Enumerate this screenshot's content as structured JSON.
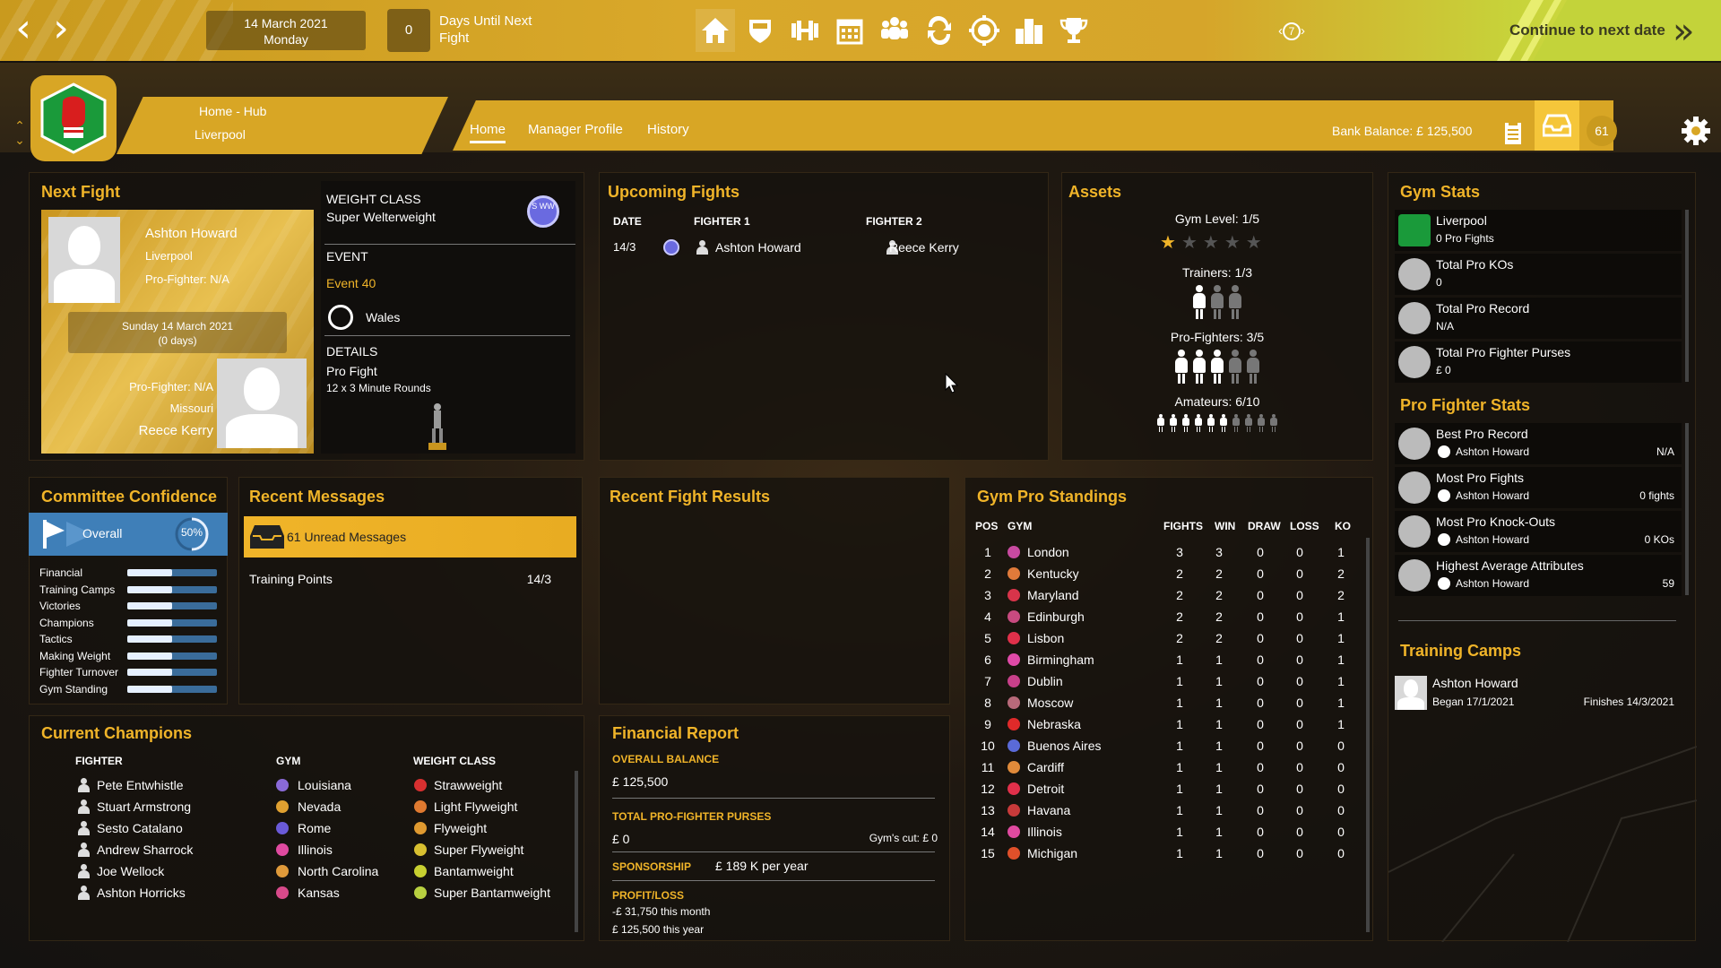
{
  "topbar": {
    "date_line1": "14 March 2021",
    "date_line2": "Monday",
    "days_until": "0",
    "days_label": "Days Until Next Fight",
    "icons": [
      "home-icon",
      "shield-icon",
      "dumbbell-icon",
      "calendar-icon",
      "fighters-icon",
      "transfer-icon",
      "target-icon",
      "rankings-icon",
      "trophy-icon"
    ],
    "round_badge": "7",
    "continue_label": "Continue to next date"
  },
  "header": {
    "crumb_title": "Home - Hub",
    "crumb_sub": "Liverpool",
    "tabs": [
      "Home",
      "Manager Profile",
      "History"
    ],
    "bank_balance": "Bank Balance: £ 125,500",
    "inbox_count": "61"
  },
  "next_fight": {
    "title": "Next Fight",
    "fighter1_name": "Ashton Howard",
    "fighter1_gym": "Liverpool",
    "fighter1_status": "Pro-Fighter: N/A",
    "date_line1": "Sunday 14 March 2021",
    "date_line2": "(0 days)",
    "fighter2_status": "Pro-Fighter: N/A",
    "fighter2_gym": "Missouri",
    "fighter2_name": "Reece Kerry",
    "weight_class_label": "WEIGHT CLASS",
    "weight_class": "Super Welterweight",
    "weight_badge": "S WW",
    "event_label": "EVENT",
    "event": "Event 40",
    "location": "Wales",
    "details_label": "DETAILS",
    "details_type": "Pro Fight",
    "details_rounds": "12 x 3 Minute Rounds"
  },
  "upcoming": {
    "title": "Upcoming Fights",
    "headers": [
      "DATE",
      "FIGHTER 1",
      "FIGHTER 2"
    ],
    "rows": [
      {
        "date": "14/3",
        "fighter1": "Ashton Howard",
        "fighter2": "Reece Kerry"
      }
    ]
  },
  "assets": {
    "title": "Assets",
    "gym_level": "Gym Level: 1/5",
    "gym_level_value": 1,
    "trainers": "Trainers: 1/3",
    "trainers_value": 1,
    "trainers_max": 3,
    "pro_fighters": "Pro-Fighters: 3/5",
    "pro_value": 3,
    "pro_max": 5,
    "amateurs": "Amateurs: 6/10",
    "amateur_value": 6,
    "amateur_max": 10
  },
  "gym_stats": {
    "title": "Gym Stats",
    "items": [
      {
        "label": "Liverpool",
        "value": "0 Pro Fights"
      },
      {
        "label": "Total Pro KOs",
        "value": "0"
      },
      {
        "label": "Total Pro Record",
        "value": "N/A"
      },
      {
        "label": "Total Pro Fighter Purses",
        "value": "£ 0"
      }
    ]
  },
  "pro_fighter_stats": {
    "title": "Pro Fighter Stats",
    "items": [
      {
        "label": "Best Pro Record",
        "fighter": "Ashton Howard",
        "value": "N/A"
      },
      {
        "label": "Most Pro Fights",
        "fighter": "Ashton Howard",
        "value": "0 fights"
      },
      {
        "label": "Most Pro Knock-Outs",
        "fighter": "Ashton Howard",
        "value": "0 KOs"
      },
      {
        "label": "Highest Average Attributes",
        "fighter": "Ashton Howard",
        "value": "59"
      }
    ]
  },
  "training_camps": {
    "title": "Training Camps",
    "fighter": "Ashton Howard",
    "began": "Began 17/1/2021",
    "finishes": "Finishes 14/3/2021"
  },
  "committee": {
    "title": "Committee Confidence",
    "overall_label": "Overall",
    "overall_value": "50%",
    "overall_fraction": 0.5,
    "items": [
      {
        "label": "Financial",
        "fraction": 0.5
      },
      {
        "label": "Training Camps",
        "fraction": 0.5
      },
      {
        "label": "Victories",
        "fraction": 0.5
      },
      {
        "label": "Champions",
        "fraction": 0.5
      },
      {
        "label": "Tactics",
        "fraction": 0.5
      },
      {
        "label": "Making Weight",
        "fraction": 0.5
      },
      {
        "label": "Fighter Turnover",
        "fraction": 0.5
      },
      {
        "label": "Gym Standing",
        "fraction": 0.5
      }
    ]
  },
  "messages": {
    "title": "Recent Messages",
    "unread": "61 Unread Messages",
    "items": [
      {
        "label": "Training Points",
        "date": "14/3"
      }
    ]
  },
  "results": {
    "title": "Recent Fight Results"
  },
  "standings": {
    "title": "Gym Pro Standings",
    "headers": [
      "POS",
      "GYM",
      "FIGHTS",
      "WIN",
      "DRAW",
      "LOSS",
      "KO"
    ],
    "rows": [
      {
        "pos": "1",
        "gym": "London",
        "fights": "3",
        "win": "3",
        "draw": "0",
        "loss": "0",
        "ko": "1",
        "color": "#c84aa0"
      },
      {
        "pos": "2",
        "gym": "Kentucky",
        "fights": "2",
        "win": "2",
        "draw": "0",
        "loss": "0",
        "ko": "2",
        "color": "#e07a3a"
      },
      {
        "pos": "3",
        "gym": "Maryland",
        "fights": "2",
        "win": "2",
        "draw": "0",
        "loss": "0",
        "ko": "2",
        "color": "#d8344a"
      },
      {
        "pos": "4",
        "gym": "Edinburgh",
        "fights": "2",
        "win": "2",
        "draw": "0",
        "loss": "0",
        "ko": "1",
        "color": "#c84a80"
      },
      {
        "pos": "5",
        "gym": "Lisbon",
        "fights": "2",
        "win": "2",
        "draw": "0",
        "loss": "0",
        "ko": "1",
        "color": "#e0304a"
      },
      {
        "pos": "6",
        "gym": "Birmingham",
        "fights": "1",
        "win": "1",
        "draw": "0",
        "loss": "0",
        "ko": "1",
        "color": "#e04aa8"
      },
      {
        "pos": "7",
        "gym": "Dublin",
        "fights": "1",
        "win": "1",
        "draw": "0",
        "loss": "0",
        "ko": "1",
        "color": "#c8408a"
      },
      {
        "pos": "8",
        "gym": "Moscow",
        "fights": "1",
        "win": "1",
        "draw": "0",
        "loss": "0",
        "ko": "1",
        "color": "#b86a7a"
      },
      {
        "pos": "9",
        "gym": "Nebraska",
        "fights": "1",
        "win": "1",
        "draw": "0",
        "loss": "0",
        "ko": "1",
        "color": "#e02a2a"
      },
      {
        "pos": "10",
        "gym": "Buenos Aires",
        "fights": "1",
        "win": "1",
        "draw": "0",
        "loss": "0",
        "ko": "0",
        "color": "#5a6ad8"
      },
      {
        "pos": "11",
        "gym": "Cardiff",
        "fights": "1",
        "win": "1",
        "draw": "0",
        "loss": "0",
        "ko": "0",
        "color": "#e08a3a"
      },
      {
        "pos": "12",
        "gym": "Detroit",
        "fights": "1",
        "win": "1",
        "draw": "0",
        "loss": "0",
        "ko": "0",
        "color": "#e0304a"
      },
      {
        "pos": "13",
        "gym": "Havana",
        "fights": "1",
        "win": "1",
        "draw": "0",
        "loss": "0",
        "ko": "0",
        "color": "#c83a3a"
      },
      {
        "pos": "14",
        "gym": "Illinois",
        "fights": "1",
        "win": "1",
        "draw": "0",
        "loss": "0",
        "ko": "0",
        "color": "#e04aa0"
      },
      {
        "pos": "15",
        "gym": "Michigan",
        "fights": "1",
        "win": "1",
        "draw": "0",
        "loss": "0",
        "ko": "0",
        "color": "#e0502a"
      }
    ]
  },
  "champions": {
    "title": "Current Champions",
    "headers": [
      "FIGHTER",
      "GYM",
      "WEIGHT CLASS"
    ],
    "rows": [
      {
        "fighter": "Pete Entwhistle",
        "gym": "Louisiana",
        "weight": "Strawweight",
        "gym_color": "#8a6ad8",
        "wc_color": "#d83030"
      },
      {
        "fighter": "Stuart Armstrong",
        "gym": "Nevada",
        "weight": "Light Flyweight",
        "gym_color": "#e0a030",
        "wc_color": "#e07a30"
      },
      {
        "fighter": "Sesto Catalano",
        "gym": "Rome",
        "weight": "Flyweight",
        "gym_color": "#6a5ad8",
        "wc_color": "#e09a30"
      },
      {
        "fighter": "Andrew Sharrock",
        "gym": "Illinois",
        "weight": "Super Flyweight",
        "gym_color": "#e04aa0",
        "wc_color": "#d8c030"
      },
      {
        "fighter": "Joe Wellock",
        "gym": "North Carolina",
        "weight": "Bantamweight",
        "gym_color": "#e09a3a",
        "wc_color": "#c8d030"
      },
      {
        "fighter": "Ashton Horricks",
        "gym": "Kansas",
        "weight": "Super Bantamweight",
        "gym_color": "#d84a8a",
        "wc_color": "#b8d040"
      }
    ]
  },
  "financial": {
    "title": "Financial Report",
    "overall_label": "OVERALL BALANCE",
    "overall_value": "£ 125,500",
    "purses_label": "TOTAL PRO-FIGHTER PURSES",
    "purses_value": "£ 0",
    "gyms_cut": "Gym's cut: £ 0",
    "sponsorship_label": "SPONSORSHIP",
    "sponsorship_value": "£ 189 K per year",
    "pl_label": "PROFIT/LOSS",
    "pl_month": "-£ 31,750 this month",
    "pl_year": "£ 125,500 this year"
  },
  "colors": {
    "accent": "#f0b429",
    "topbar": "#d6a52a",
    "continue": "#c7d33a",
    "committee_blue": "#3a6c9a"
  }
}
